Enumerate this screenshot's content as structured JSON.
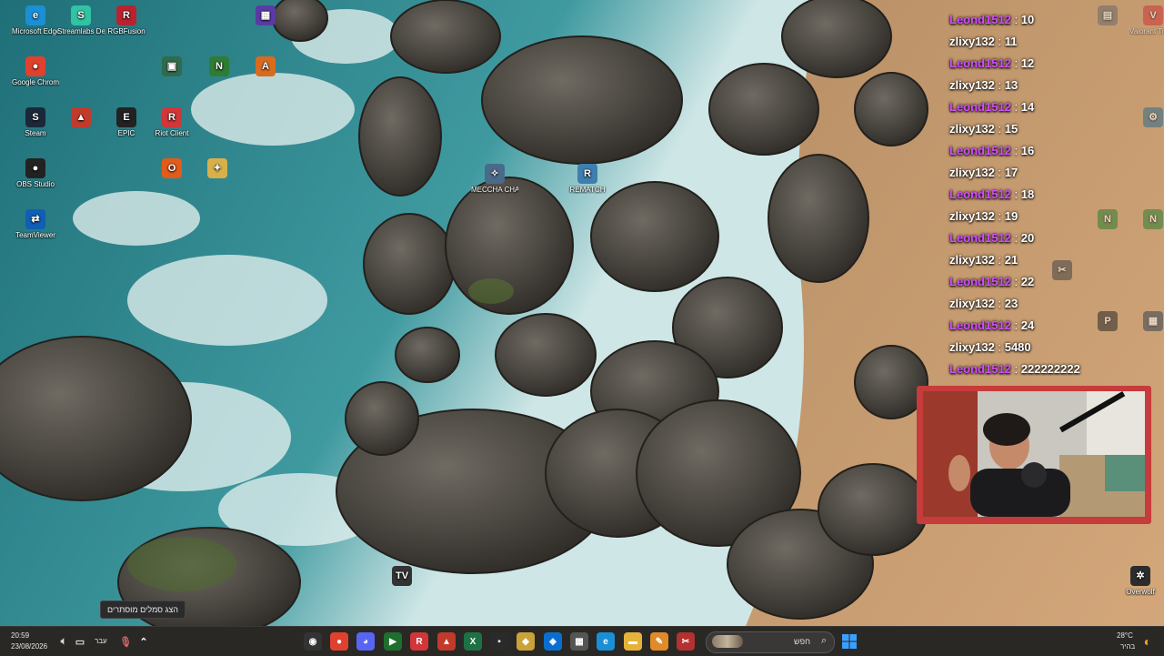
{
  "desktop": {
    "icons": [
      {
        "label": "Microsoft Edge",
        "glyph": "e",
        "color": "#1a8fd6"
      },
      {
        "label": "Streamlabs Desktop",
        "glyph": "S",
        "color": "#31c3a2"
      },
      {
        "label": "RGBFusion",
        "glyph": "R",
        "color": "#b8232f"
      },
      {
        "label": "",
        "glyph": "▦",
        "color": "#5b3aa6"
      },
      {
        "label": "Google Chrome",
        "glyph": "●",
        "color": "#e0412f"
      },
      {
        "label": "",
        "glyph": "▣",
        "color": "#2f6b4c"
      },
      {
        "label": "",
        "glyph": "N",
        "color": "#2e7d32"
      },
      {
        "label": "",
        "glyph": "A",
        "color": "#d86b1f"
      },
      {
        "label": "Steam",
        "glyph": "S",
        "color": "#1b2838"
      },
      {
        "label": "",
        "glyph": "▲",
        "color": "#c23a2b"
      },
      {
        "label": "EPIC",
        "glyph": "E",
        "color": "#222222"
      },
      {
        "label": "Riot Client",
        "glyph": "R",
        "color": "#d13639"
      },
      {
        "label": "OBS Studio",
        "glyph": "●",
        "color": "#222222"
      },
      {
        "label": "",
        "glyph": "O",
        "color": "#e25b1a"
      },
      {
        "label": "",
        "glyph": "✦",
        "color": "#d8b04a"
      },
      {
        "label": "TeamViewer",
        "glyph": "⇄",
        "color": "#0e5fb5"
      },
      {
        "label": "MECCHA CHAMELEON",
        "glyph": "✧",
        "color": "#4a6a8a"
      },
      {
        "label": "REMATCH",
        "glyph": "R",
        "color": "#3f7fb0"
      },
      {
        "label": "",
        "glyph": "TV",
        "color": "#333333"
      },
      {
        "label": "Overwolf",
        "glyph": "✲",
        "color": "#2c2c2c"
      }
    ],
    "right_icons": [
      {
        "label": "",
        "glyph": "▤",
        "color": "#6a6a6a"
      },
      {
        "label": "Valorant Tracker",
        "glyph": "V",
        "color": "#d13639"
      },
      {
        "label": "",
        "glyph": "⚙",
        "color": "#2f6b8c"
      },
      {
        "label": "",
        "glyph": "N",
        "color": "#2e7d32"
      },
      {
        "label": "",
        "glyph": "N",
        "color": "#2e7d32"
      },
      {
        "label": "",
        "glyph": "✂",
        "color": "#444444"
      },
      {
        "label": "",
        "glyph": "P",
        "color": "#2a2a2a"
      },
      {
        "label": "",
        "glyph": "▦",
        "color": "#345"
      }
    ]
  },
  "chat": {
    "colors": {
      "Leond1512": "#d44dff",
      "zlixy132": "#ffffff"
    },
    "messages": [
      {
        "user": "Leond1512",
        "text": "10"
      },
      {
        "user": "zlixy132",
        "text": "11"
      },
      {
        "user": "Leond1512",
        "text": "12"
      },
      {
        "user": "zlixy132",
        "text": "13"
      },
      {
        "user": "Leond1512",
        "text": "14"
      },
      {
        "user": "zlixy132",
        "text": "15"
      },
      {
        "user": "Leond1512",
        "text": "16"
      },
      {
        "user": "zlixy132",
        "text": "17"
      },
      {
        "user": "Leond1512",
        "text": "18"
      },
      {
        "user": "zlixy132",
        "text": "19"
      },
      {
        "user": "Leond1512",
        "text": "20"
      },
      {
        "user": "zlixy132",
        "text": "21"
      },
      {
        "user": "Leond1512",
        "text": "22"
      },
      {
        "user": "zlixy132",
        "text": "23"
      },
      {
        "user": "Leond1512",
        "text": "24"
      },
      {
        "user": "zlixy132",
        "text": "5480"
      },
      {
        "user": "Leond1512",
        "text": "222222222"
      }
    ]
  },
  "tooltip": {
    "text": "הצג סמלים מוסתרים"
  },
  "taskbar": {
    "clock_time": "20:59",
    "clock_date": "23/08/2026",
    "language": "עבר",
    "search_placeholder": "חפש",
    "weather_temp": "28°C",
    "weather_desc": "בהיר",
    "pinned": [
      {
        "name": "obs-taskbar-icon",
        "glyph": "◉",
        "color": "#333333"
      },
      {
        "name": "chrome-taskbar-icon",
        "glyph": "●",
        "color": "#e0412f"
      },
      {
        "name": "discord-taskbar-icon",
        "glyph": "◕",
        "color": "#5865f2"
      },
      {
        "name": "terminal-taskbar-icon",
        "glyph": "▶",
        "color": "#1f6f2e"
      },
      {
        "name": "riot-taskbar-icon",
        "glyph": "R",
        "color": "#d13639"
      },
      {
        "name": "valorant-taskbar-icon",
        "glyph": "▲",
        "color": "#c23a2b"
      },
      {
        "name": "excel-taskbar-icon",
        "glyph": "X",
        "color": "#1e7145"
      },
      {
        "name": "app-taskbar-icon",
        "glyph": "▪",
        "color": "#2a2a2a"
      },
      {
        "name": "box-taskbar-icon",
        "glyph": "◆",
        "color": "#c9a23a"
      },
      {
        "name": "store-taskbar-icon",
        "glyph": "◈",
        "color": "#0a6ed1"
      },
      {
        "name": "calculator-taskbar-icon",
        "glyph": "▦",
        "color": "#555555"
      },
      {
        "name": "edge-taskbar-icon",
        "glyph": "e",
        "color": "#1a8fd6"
      },
      {
        "name": "file-explorer-taskbar-icon",
        "glyph": "▬",
        "color": "#e5b33a"
      },
      {
        "name": "paint-taskbar-icon",
        "glyph": "✎",
        "color": "#e08a2a"
      },
      {
        "name": "snipping-taskbar-icon",
        "glyph": "✂",
        "color": "#b3322f"
      }
    ],
    "start_color": "#1e90ff"
  }
}
